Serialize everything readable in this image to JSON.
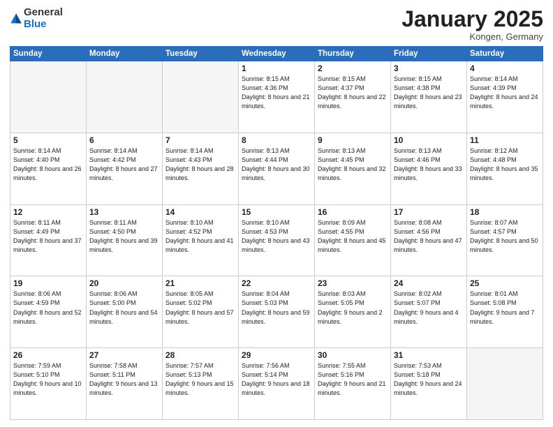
{
  "logo": {
    "general": "General",
    "blue": "Blue"
  },
  "title": "January 2025",
  "location": "Kongen, Germany",
  "days_header": [
    "Sunday",
    "Monday",
    "Tuesday",
    "Wednesday",
    "Thursday",
    "Friday",
    "Saturday"
  ],
  "weeks": [
    [
      {
        "day": "",
        "empty": true
      },
      {
        "day": "",
        "empty": true
      },
      {
        "day": "",
        "empty": true
      },
      {
        "day": "1",
        "info": "Sunrise: 8:15 AM\nSunset: 4:36 PM\nDaylight: 8 hours\nand 21 minutes."
      },
      {
        "day": "2",
        "info": "Sunrise: 8:15 AM\nSunset: 4:37 PM\nDaylight: 8 hours\nand 22 minutes."
      },
      {
        "day": "3",
        "info": "Sunrise: 8:15 AM\nSunset: 4:38 PM\nDaylight: 8 hours\nand 23 minutes."
      },
      {
        "day": "4",
        "info": "Sunrise: 8:14 AM\nSunset: 4:39 PM\nDaylight: 8 hours\nand 24 minutes."
      }
    ],
    [
      {
        "day": "5",
        "info": "Sunrise: 8:14 AM\nSunset: 4:40 PM\nDaylight: 8 hours\nand 26 minutes."
      },
      {
        "day": "6",
        "info": "Sunrise: 8:14 AM\nSunset: 4:42 PM\nDaylight: 8 hours\nand 27 minutes."
      },
      {
        "day": "7",
        "info": "Sunrise: 8:14 AM\nSunset: 4:43 PM\nDaylight: 8 hours\nand 28 minutes."
      },
      {
        "day": "8",
        "info": "Sunrise: 8:13 AM\nSunset: 4:44 PM\nDaylight: 8 hours\nand 30 minutes."
      },
      {
        "day": "9",
        "info": "Sunrise: 8:13 AM\nSunset: 4:45 PM\nDaylight: 8 hours\nand 32 minutes."
      },
      {
        "day": "10",
        "info": "Sunrise: 8:13 AM\nSunset: 4:46 PM\nDaylight: 8 hours\nand 33 minutes."
      },
      {
        "day": "11",
        "info": "Sunrise: 8:12 AM\nSunset: 4:48 PM\nDaylight: 8 hours\nand 35 minutes."
      }
    ],
    [
      {
        "day": "12",
        "info": "Sunrise: 8:11 AM\nSunset: 4:49 PM\nDaylight: 8 hours\nand 37 minutes."
      },
      {
        "day": "13",
        "info": "Sunrise: 8:11 AM\nSunset: 4:50 PM\nDaylight: 8 hours\nand 39 minutes."
      },
      {
        "day": "14",
        "info": "Sunrise: 8:10 AM\nSunset: 4:52 PM\nDaylight: 8 hours\nand 41 minutes."
      },
      {
        "day": "15",
        "info": "Sunrise: 8:10 AM\nSunset: 4:53 PM\nDaylight: 8 hours\nand 43 minutes."
      },
      {
        "day": "16",
        "info": "Sunrise: 8:09 AM\nSunset: 4:55 PM\nDaylight: 8 hours\nand 45 minutes."
      },
      {
        "day": "17",
        "info": "Sunrise: 8:08 AM\nSunset: 4:56 PM\nDaylight: 8 hours\nand 47 minutes."
      },
      {
        "day": "18",
        "info": "Sunrise: 8:07 AM\nSunset: 4:57 PM\nDaylight: 8 hours\nand 50 minutes."
      }
    ],
    [
      {
        "day": "19",
        "info": "Sunrise: 8:06 AM\nSunset: 4:59 PM\nDaylight: 8 hours\nand 52 minutes."
      },
      {
        "day": "20",
        "info": "Sunrise: 8:06 AM\nSunset: 5:00 PM\nDaylight: 8 hours\nand 54 minutes."
      },
      {
        "day": "21",
        "info": "Sunrise: 8:05 AM\nSunset: 5:02 PM\nDaylight: 8 hours\nand 57 minutes."
      },
      {
        "day": "22",
        "info": "Sunrise: 8:04 AM\nSunset: 5:03 PM\nDaylight: 8 hours\nand 59 minutes."
      },
      {
        "day": "23",
        "info": "Sunrise: 8:03 AM\nSunset: 5:05 PM\nDaylight: 9 hours\nand 2 minutes."
      },
      {
        "day": "24",
        "info": "Sunrise: 8:02 AM\nSunset: 5:07 PM\nDaylight: 9 hours\nand 4 minutes."
      },
      {
        "day": "25",
        "info": "Sunrise: 8:01 AM\nSunset: 5:08 PM\nDaylight: 9 hours\nand 7 minutes."
      }
    ],
    [
      {
        "day": "26",
        "info": "Sunrise: 7:59 AM\nSunset: 5:10 PM\nDaylight: 9 hours\nand 10 minutes."
      },
      {
        "day": "27",
        "info": "Sunrise: 7:58 AM\nSunset: 5:11 PM\nDaylight: 9 hours\nand 13 minutes."
      },
      {
        "day": "28",
        "info": "Sunrise: 7:57 AM\nSunset: 5:13 PM\nDaylight: 9 hours\nand 15 minutes."
      },
      {
        "day": "29",
        "info": "Sunrise: 7:56 AM\nSunset: 5:14 PM\nDaylight: 9 hours\nand 18 minutes."
      },
      {
        "day": "30",
        "info": "Sunrise: 7:55 AM\nSunset: 5:16 PM\nDaylight: 9 hours\nand 21 minutes."
      },
      {
        "day": "31",
        "info": "Sunrise: 7:53 AM\nSunset: 5:18 PM\nDaylight: 9 hours\nand 24 minutes."
      },
      {
        "day": "",
        "empty": true
      }
    ]
  ]
}
